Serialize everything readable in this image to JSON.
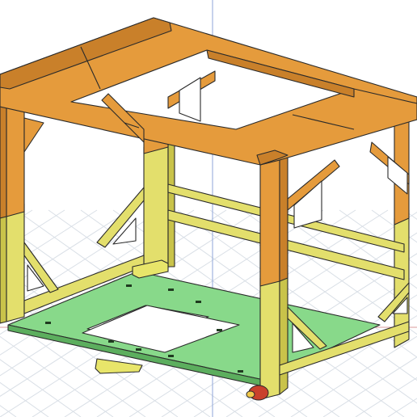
{
  "viewport": {
    "background": "#ffffff",
    "grid_color": "#d9dfe6",
    "axis_vertical_color": "#8fa6d8",
    "axis_horizontal_color": "#d99b9b"
  },
  "model": {
    "upper_frame_color": "#e59b3c",
    "upper_frame_shade": "#c9802a",
    "lower_frame_color": "#e3df6c",
    "lower_frame_shade": "#c9c34a",
    "bed_color": "#88d98a",
    "bed_edge_color": "#5cae5e",
    "small_part_color": "#e8e56a",
    "knob_color": "#c9402c",
    "knob_tip_color": "#f2c94a",
    "edge_color": "#2a2a2a"
  }
}
